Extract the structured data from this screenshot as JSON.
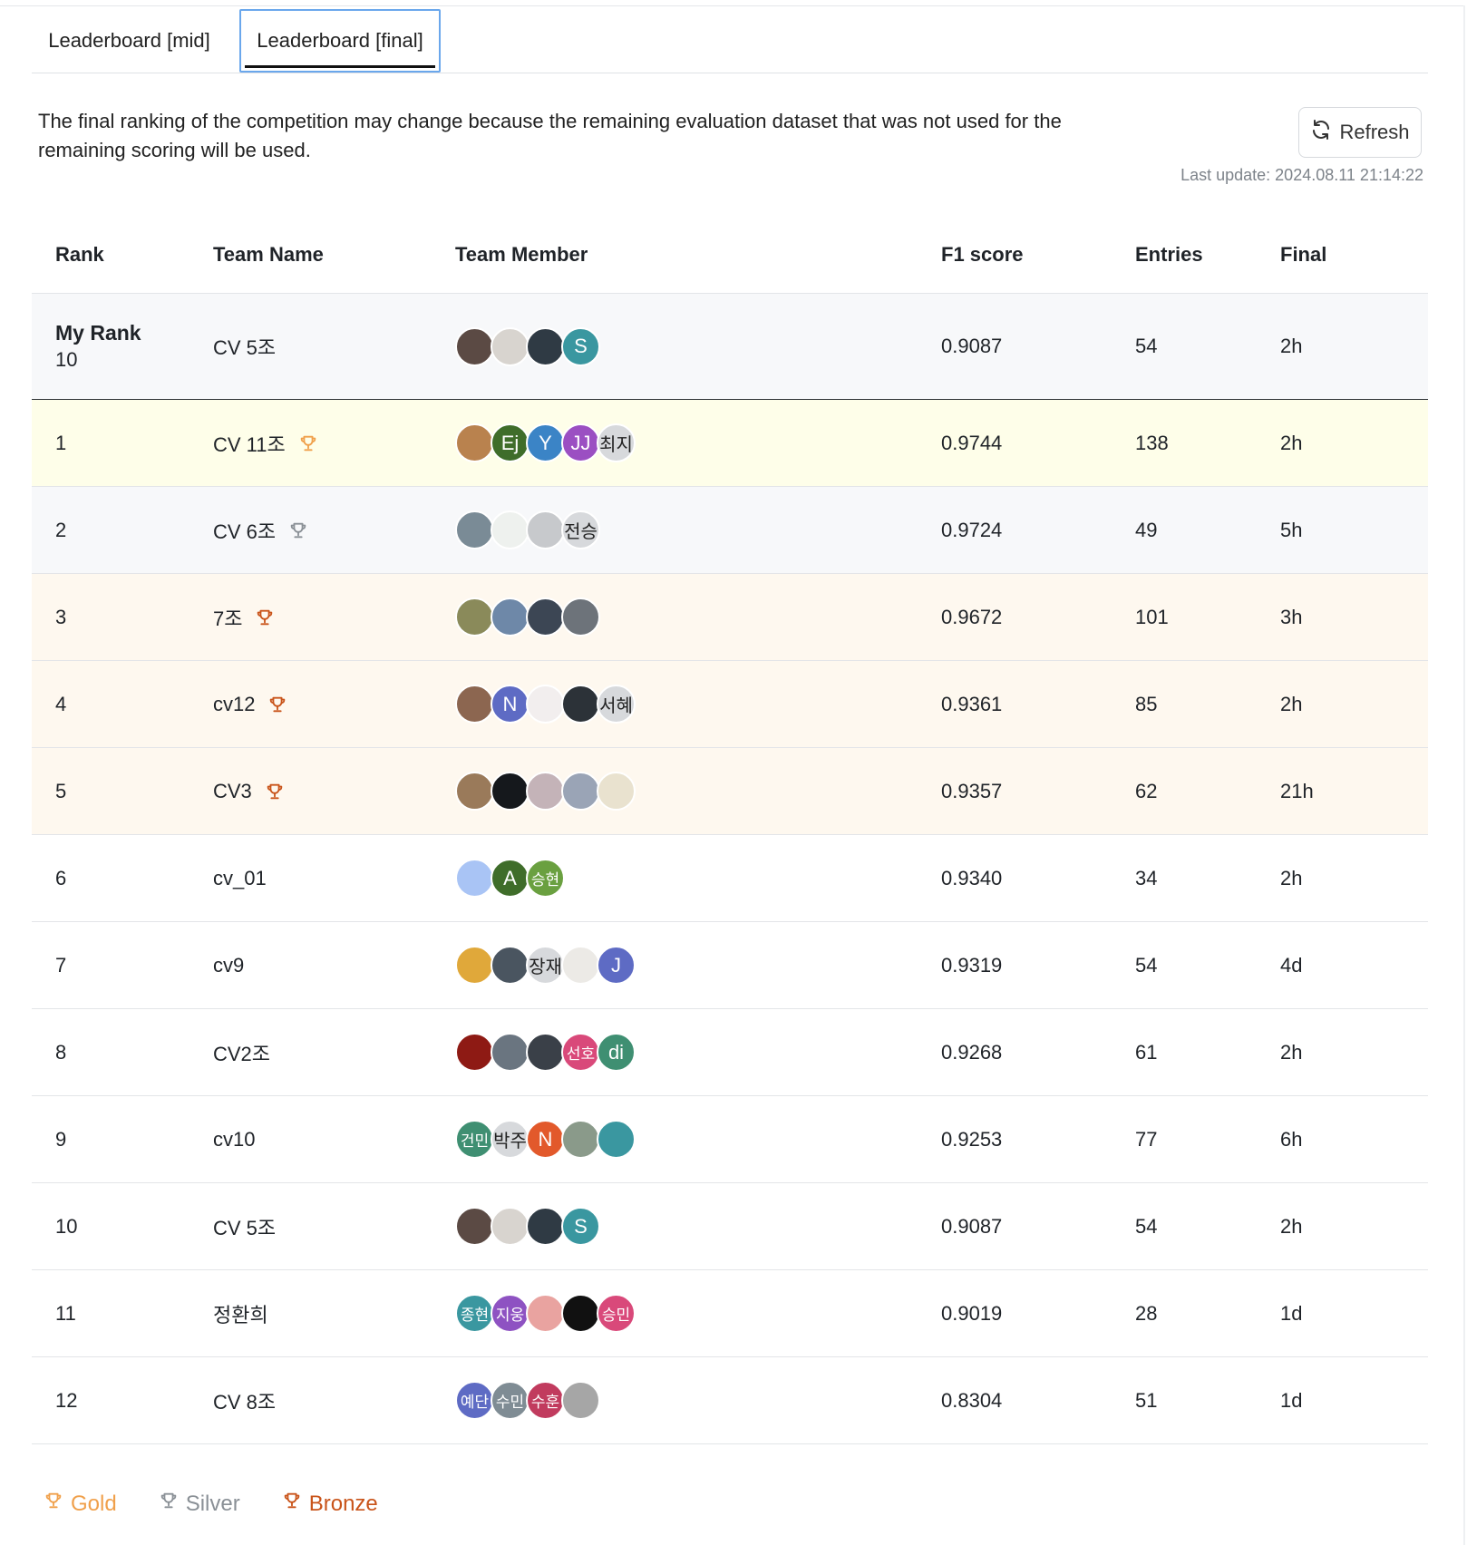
{
  "tabs": [
    {
      "label": "Leaderboard [mid]",
      "active": false
    },
    {
      "label": "Leaderboard [final]",
      "active": true
    }
  ],
  "notice": "The final ranking of the competition may change because the remaining evaluation dataset that was not used for the remaining scoring will be used.",
  "refresh_label": "Refresh",
  "last_update": "Last update: 2024.08.11 21:14:22",
  "columns": [
    "Rank",
    "Team Name",
    "Team Member",
    "F1 score",
    "Entries",
    "Final"
  ],
  "my_rank": {
    "label": "My Rank",
    "rank": "10",
    "team": "CV 5조",
    "f1": "0.9087",
    "entries": "54",
    "final": "2h",
    "members": [
      {
        "text": "",
        "color": "#5b4a44"
      },
      {
        "text": "",
        "color": "#d8d4cf"
      },
      {
        "text": "",
        "color": "#2f3a44"
      },
      {
        "text": "S",
        "color": "#3a97a0"
      }
    ]
  },
  "rows": [
    {
      "rank": "1",
      "team": "CV 11조",
      "medal": "gold",
      "f1": "0.9744",
      "entries": "138",
      "final": "2h",
      "members": [
        {
          "text": "",
          "color": "#b9824e"
        },
        {
          "text": "Ej",
          "color": "#3f6d2a"
        },
        {
          "text": "Y",
          "color": "#3b84c6"
        },
        {
          "text": "JJ",
          "color": "#9b4fc2"
        },
        {
          "text": "최지",
          "color": "#d7d9dc",
          "dark": true
        }
      ]
    },
    {
      "rank": "2",
      "team": "CV 6조",
      "medal": "silver",
      "f1": "0.9724",
      "entries": "49",
      "final": "5h",
      "members": [
        {
          "text": "",
          "color": "#7a8b96"
        },
        {
          "text": "",
          "color": "#eef1ee"
        },
        {
          "text": "",
          "color": "#c7c9cc"
        },
        {
          "text": "전승",
          "color": "#d7d9dc",
          "dark": true
        }
      ]
    },
    {
      "rank": "3",
      "team": "7조",
      "medal": "bronze",
      "f1": "0.9672",
      "entries": "101",
      "final": "3h",
      "members": [
        {
          "text": "",
          "color": "#8a8a5a"
        },
        {
          "text": "",
          "color": "#6e88a8"
        },
        {
          "text": "",
          "color": "#3c4654"
        },
        {
          "text": "",
          "color": "#6d737a"
        }
      ]
    },
    {
      "rank": "4",
      "team": "cv12",
      "medal": "bronze",
      "f1": "0.9361",
      "entries": "85",
      "final": "2h",
      "members": [
        {
          "text": "",
          "color": "#8c6650"
        },
        {
          "text": "N",
          "color": "#5e6bc4"
        },
        {
          "text": "",
          "color": "#f2eeee"
        },
        {
          "text": "",
          "color": "#2c3238"
        },
        {
          "text": "서혜",
          "color": "#d7d9dc",
          "dark": true
        }
      ]
    },
    {
      "rank": "5",
      "team": "CV3",
      "medal": "bronze",
      "f1": "0.9357",
      "entries": "62",
      "final": "21h",
      "members": [
        {
          "text": "",
          "color": "#9a7a5a"
        },
        {
          "text": "",
          "color": "#15181c"
        },
        {
          "text": "",
          "color": "#c4b3b8"
        },
        {
          "text": "",
          "color": "#9aa4b6"
        },
        {
          "text": "",
          "color": "#e9e2cf"
        }
      ]
    },
    {
      "rank": "6",
      "team": "cv_01",
      "medal": "",
      "f1": "0.9340",
      "entries": "34",
      "final": "2h",
      "members": [
        {
          "text": "",
          "color": "#a9c4f5"
        },
        {
          "text": "A",
          "color": "#3f6d2a"
        },
        {
          "text": "승현",
          "color": "#6aa040",
          "small": true
        }
      ]
    },
    {
      "rank": "7",
      "team": "cv9",
      "medal": "",
      "f1": "0.9319",
      "entries": "54",
      "final": "4d",
      "members": [
        {
          "text": "",
          "color": "#e0a83a"
        },
        {
          "text": "",
          "color": "#4a5560"
        },
        {
          "text": "장재",
          "color": "#d7d9dc",
          "dark": true
        },
        {
          "text": "",
          "color": "#eceae6"
        },
        {
          "text": "J",
          "color": "#5e6bc4"
        }
      ]
    },
    {
      "rank": "8",
      "team": "CV2조",
      "medal": "",
      "f1": "0.9268",
      "entries": "61",
      "final": "2h",
      "members": [
        {
          "text": "",
          "color": "#8e1a14"
        },
        {
          "text": "",
          "color": "#6a7580"
        },
        {
          "text": "",
          "color": "#3a4048"
        },
        {
          "text": "선호",
          "color": "#d9497a",
          "small": true
        },
        {
          "text": "di",
          "color": "#3f8f72"
        }
      ]
    },
    {
      "rank": "9",
      "team": "cv10",
      "medal": "",
      "f1": "0.9253",
      "entries": "77",
      "final": "6h",
      "members": [
        {
          "text": "건민",
          "color": "#3f8f72",
          "small": true
        },
        {
          "text": "박주",
          "color": "#d7d9dc",
          "dark": true
        },
        {
          "text": "N",
          "color": "#e2592b"
        },
        {
          "text": "",
          "color": "#8a9a8a"
        },
        {
          "text": "",
          "color": "#3a97a0"
        }
      ]
    },
    {
      "rank": "10",
      "team": "CV 5조",
      "medal": "",
      "f1": "0.9087",
      "entries": "54",
      "final": "2h",
      "members": [
        {
          "text": "",
          "color": "#5b4a44"
        },
        {
          "text": "",
          "color": "#d8d4cf"
        },
        {
          "text": "",
          "color": "#2f3a44"
        },
        {
          "text": "S",
          "color": "#3a97a0"
        }
      ]
    },
    {
      "rank": "11",
      "team": "정환희",
      "medal": "",
      "f1": "0.9019",
      "entries": "28",
      "final": "1d",
      "members": [
        {
          "text": "종현",
          "color": "#3a97a0",
          "small": true
        },
        {
          "text": "지웅",
          "color": "#8e52c2",
          "small": true
        },
        {
          "text": "",
          "color": "#e9a3a0"
        },
        {
          "text": "",
          "color": "#111111"
        },
        {
          "text": "승민",
          "color": "#d9497a",
          "small": true
        }
      ]
    },
    {
      "rank": "12",
      "team": "CV 8조",
      "medal": "",
      "f1": "0.8304",
      "entries": "51",
      "final": "1d",
      "members": [
        {
          "text": "예단",
          "color": "#5e6bc4",
          "small": true
        },
        {
          "text": "수민",
          "color": "#7f8c94",
          "small": true
        },
        {
          "text": "수훈",
          "color": "#c13b5e",
          "small": true
        },
        {
          "text": "",
          "color": "#a6a6a6"
        }
      ]
    }
  ],
  "legend": [
    {
      "label": "Gold",
      "color": "#f0a04b"
    },
    {
      "label": "Silver",
      "color": "#8a9096"
    },
    {
      "label": "Bronze",
      "color": "#c9541a"
    }
  ],
  "medal_colors": {
    "gold": "#f0a04b",
    "silver": "#8a9096",
    "bronze": "#c9541a"
  }
}
